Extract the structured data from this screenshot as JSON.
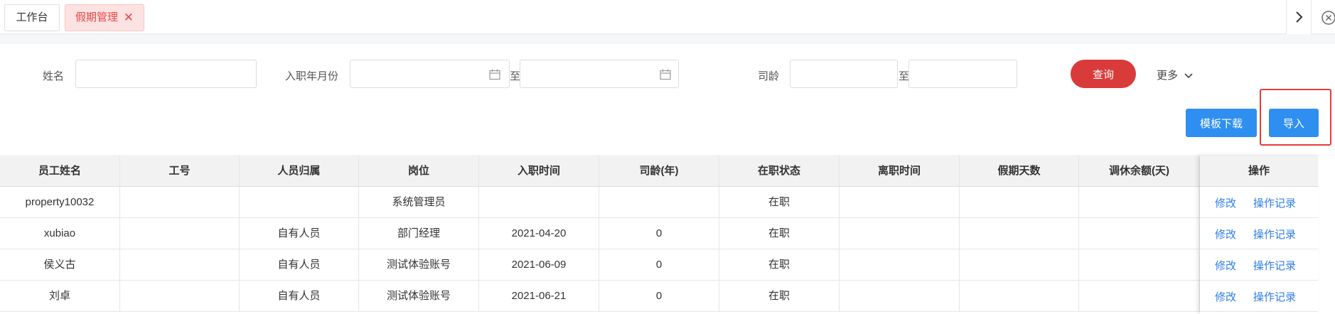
{
  "tabs": [
    {
      "label": "工作台",
      "active": false
    },
    {
      "label": "假期管理",
      "active": true
    }
  ],
  "search": {
    "name_label": "姓名",
    "hire_month_label": "入职年月份",
    "range_sep": "至",
    "seniority_label": "司龄",
    "query_button": "查询",
    "more_label": "更多"
  },
  "actions": {
    "template_download": "模板下载",
    "import": "导入"
  },
  "table": {
    "headers": [
      "员工姓名",
      "工号",
      "人员归属",
      "岗位",
      "入职时间",
      "司龄(年)",
      "在职状态",
      "离职时间",
      "假期天数",
      "调休余额(天)"
    ],
    "ops_header": "操作",
    "edit_label": "修改",
    "log_label": "操作记录",
    "rows": [
      [
        "property10032",
        "",
        "",
        "系统管理员",
        "",
        "",
        "在职",
        "",
        "",
        ""
      ],
      [
        "xubiao",
        "",
        "自有人员",
        "部门经理",
        "2021-04-20",
        "0",
        "在职",
        "",
        "",
        ""
      ],
      [
        "侯义古",
        "",
        "自有人员",
        "测试体验账号",
        "2021-06-09",
        "0",
        "在职",
        "",
        "",
        ""
      ],
      [
        "刘卓",
        "",
        "自有人员",
        "测试体验账号",
        "2021-06-21",
        "0",
        "在职",
        "",
        "",
        ""
      ]
    ]
  },
  "colors": {
    "accent_red": "#d93b3b",
    "accent_blue": "#2f8ff1",
    "link_blue": "#2f7ee6"
  }
}
